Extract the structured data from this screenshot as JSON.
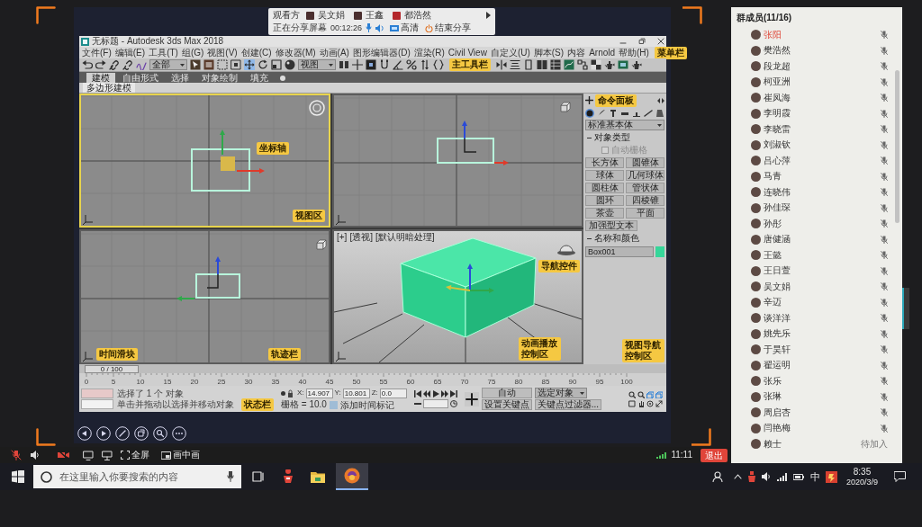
{
  "meeting_bar": {
    "viewers_label": "观看方",
    "viewers": [
      {
        "name": "吴文娟"
      },
      {
        "name": "王鑫"
      },
      {
        "name": "都浩然"
      }
    ],
    "status": "正在分享屏幕",
    "duration": "00:12:26",
    "quality": "高清",
    "stop_sharing": "结束分享"
  },
  "app_window": {
    "title": "无标题 - Autodesk 3ds Max 2018",
    "menu_bar": {
      "items": [
        "文件(F)",
        "编辑(E)",
        "工具(T)",
        "组(G)",
        "视图(V)",
        "创建(C)",
        "修改器(M)",
        "动画(A)",
        "图形编辑器(D)",
        "渲染(R)",
        "Civil View",
        "自定义(U)",
        "脚本(S)",
        "内容",
        "Arnold",
        "帮助(H)"
      ],
      "annotation": "菜单栏"
    },
    "main_toolbar": {
      "selection_filter": "全部",
      "reference_coordinate": "视图",
      "annotation": "主工具栏"
    },
    "ribbon": {
      "tabs": [
        {
          "label": "建模",
          "selected": true
        },
        {
          "label": "自由形式",
          "selected": false
        },
        {
          "label": "选择",
          "selected": false
        },
        {
          "label": "对象绘制",
          "selected": false
        },
        {
          "label": "填充",
          "selected": false
        }
      ],
      "panel": "多边形建模"
    },
    "viewports": [
      {
        "kind": "top",
        "selected": true,
        "annotations": [
          "坐标轴",
          "视图区"
        ]
      },
      {
        "kind": "front",
        "selected": false
      },
      {
        "kind": "left",
        "selected": false
      },
      {
        "kind": "perspective",
        "selected": false,
        "labels": [
          "[+]",
          "[透视]",
          "[默认明暗处理]"
        ],
        "annotations": [
          "导航控件"
        ]
      }
    ],
    "command_panel": {
      "annotation": "命令面板",
      "tabs": [
        {
          "selected": true
        },
        {
          "selected": false
        },
        {
          "selected": false
        },
        {
          "selected": false
        },
        {
          "selected": false
        },
        {
          "selected": false
        },
        {
          "selected": false
        }
      ],
      "category": "标准基本体",
      "object_type": {
        "title": "对象类型",
        "autogrid": {
          "label": "自动栅格",
          "checked": false
        },
        "buttons": [
          "长方体",
          "圆锥体",
          "球体",
          "几何球体",
          "圆柱体",
          "管状体",
          "圆环",
          "四棱锥",
          "茶壶",
          "平面",
          "加强型文本"
        ]
      },
      "name_and_color": {
        "title": "名称和颜色",
        "name": "Box001"
      }
    },
    "time_slider": {
      "label": "0 / 100",
      "level": 0,
      "annotation": "时间滑块"
    },
    "track_bar": {
      "ticks": [
        "0",
        "5",
        "10",
        "15",
        "20",
        "25",
        "30",
        "35",
        "40",
        "45",
        "50",
        "55",
        "60",
        "65",
        "70",
        "75",
        "80",
        "85",
        "90",
        "95",
        "100"
      ],
      "annotation": "轨迹栏"
    },
    "status_bar": {
      "messages": [
        "选择了 1 个 对象",
        "单击并拖动以选择并移动对象"
      ],
      "annotation": "状态栏",
      "coordinates": [
        {
          "axis": "X:",
          "value": "14.907"
        },
        {
          "axis": "Y:",
          "value": "10.801"
        },
        {
          "axis": "Z:",
          "value": "0.0"
        }
      ],
      "grid": "栅格 = 10.0",
      "time_tag": "添加时间标记"
    },
    "animation_controls": {
      "annotation": "动画播放控制区",
      "auto_key": "自动",
      "key_target": "选定对象",
      "set_key": "设置关键点",
      "key_filters": "关键点过滤器..."
    },
    "viewport_navigation": {
      "annotation": "视图导航控制区"
    }
  },
  "participants": {
    "title": "群成员(11/16)",
    "members": [
      {
        "name": "张阳",
        "kind": "host"
      },
      {
        "name": "樊浩然",
        "kind": "member"
      },
      {
        "name": "段龙超",
        "kind": "member"
      },
      {
        "name": "柯亚洲",
        "kind": "member"
      },
      {
        "name": "崔凤海",
        "kind": "member"
      },
      {
        "name": "李明霞",
        "kind": "member"
      },
      {
        "name": "李晓雷",
        "kind": "member"
      },
      {
        "name": "刘淑钦",
        "kind": "member"
      },
      {
        "name": "吕心萍",
        "kind": "member"
      },
      {
        "name": "马青",
        "kind": "member"
      },
      {
        "name": "连晓伟",
        "kind": "member"
      },
      {
        "name": "孙佳琛",
        "kind": "member"
      },
      {
        "name": "孙彤",
        "kind": "member"
      },
      {
        "name": "唐健涵",
        "kind": "member"
      },
      {
        "name": "王懿",
        "kind": "member"
      },
      {
        "name": "王日萱",
        "kind": "member"
      },
      {
        "name": "吴文娟",
        "kind": "member"
      },
      {
        "name": "辛迈",
        "kind": "member"
      },
      {
        "name": "谈洋洋",
        "kind": "member"
      },
      {
        "name": "姚先乐",
        "kind": "member"
      },
      {
        "name": "于昊轩",
        "kind": "member"
      },
      {
        "name": "翟运明",
        "kind": "member"
      },
      {
        "name": "张乐",
        "kind": "member"
      },
      {
        "name": "张琳",
        "kind": "member"
      },
      {
        "name": "周启杏",
        "kind": "member"
      },
      {
        "name": "闫艳梅",
        "kind": "member"
      },
      {
        "name": "赖士",
        "kind": "pending",
        "note": "待加入"
      }
    ]
  },
  "meeting_toolbar": {
    "fullscreen": "全屏",
    "picture_in_picture": "画中画",
    "timer": "11:11",
    "leave": "退出"
  },
  "taskbar": {
    "search_placeholder": "在这里输入你要搜索的内容",
    "input_method": "中",
    "time": "8:35",
    "date": "2020/3/9"
  }
}
